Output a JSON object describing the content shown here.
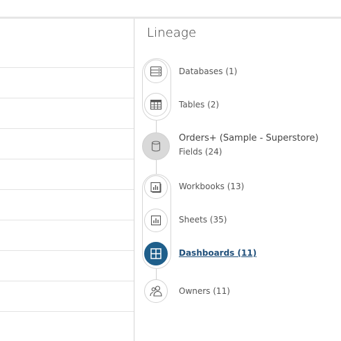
{
  "lineage": {
    "title": "Lineage",
    "nodes": [
      {
        "label": "Databases (1)",
        "icon": "database-icon"
      },
      {
        "label": "Tables (2)",
        "icon": "table-icon"
      },
      {
        "label": "Orders+ (Sample - Superstore)",
        "sub": "Fields (24)",
        "icon": "datasource-icon"
      },
      {
        "label": "Workbooks (13)",
        "icon": "workbook-icon"
      },
      {
        "label": "Sheets (35)",
        "icon": "sheet-icon"
      },
      {
        "label": "Dashboards (11)",
        "icon": "dashboard-icon",
        "active": true
      },
      {
        "label": "Owners (11)",
        "icon": "owners-icon"
      }
    ]
  },
  "colors": {
    "accent": "#1f5f8b",
    "active_text": "#1f4f7a",
    "divider": "#e3e3e3"
  }
}
